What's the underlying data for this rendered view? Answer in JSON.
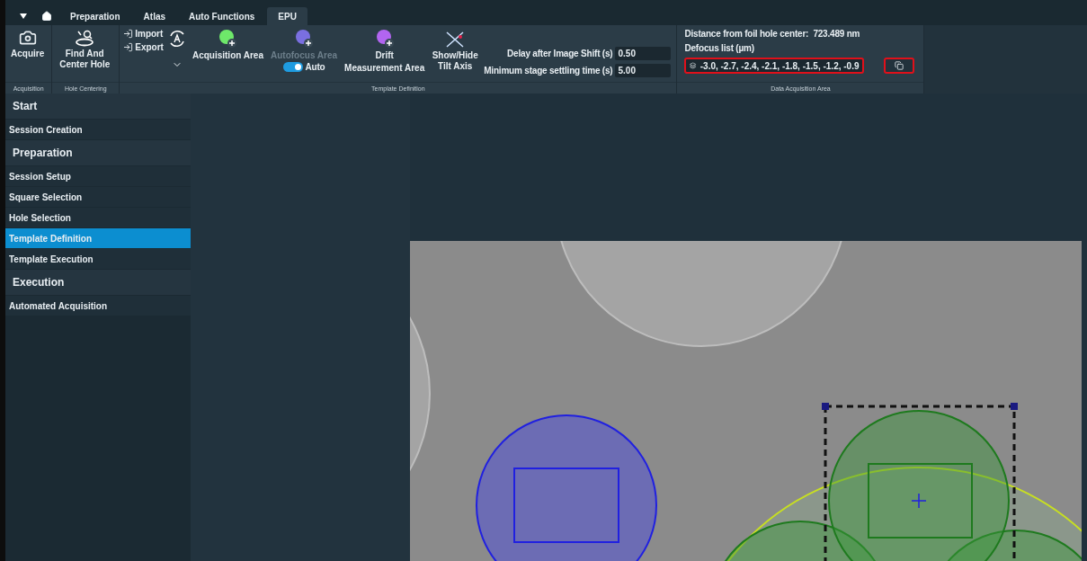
{
  "menu_tabs": [
    {
      "label": "Preparation",
      "selected": false
    },
    {
      "label": "Atlas",
      "selected": false
    },
    {
      "label": "Auto Functions",
      "selected": false
    },
    {
      "label": "EPU",
      "selected": true
    }
  ],
  "ribbon": [
    {
      "label": "Acquisition",
      "items": [
        {
          "kind": "camera",
          "label": "Acquire"
        }
      ]
    },
    {
      "label": "Hole Centering",
      "items": [
        {
          "kind": "find-hole",
          "label": "Find And Center Hole"
        }
      ]
    },
    {
      "label": "Template Definition",
      "items": [
        {
          "kind": "import-export",
          "actions": [
            "Import",
            "Export"
          ]
        },
        {
          "kind": "auto-menu"
        },
        {
          "kind": "area",
          "label": "Acquisition Area",
          "color": "#6ee86a",
          "disabled": false
        },
        {
          "kind": "area-toggle",
          "label": "Autofocus Area",
          "color": "#7a6fe0",
          "disabled": true,
          "toggle": {
            "label": "Auto",
            "on": true
          }
        },
        {
          "kind": "area",
          "label": "Drift Measurement Area",
          "color": "#b265f0",
          "disabled": false
        },
        {
          "kind": "tilt",
          "label": "Show/Hide Tilt Axis"
        },
        {
          "kind": "settings",
          "fields": [
            {
              "label": "Delay after Image Shift (s)",
              "value": "0.50"
            },
            {
              "label": "Minimum stage settling time (s)",
              "value": "5.00"
            }
          ]
        }
      ]
    },
    {
      "label": "Data Acquisition Area",
      "items": [
        {
          "kind": "data",
          "distance_label": "Distance from foil hole center:",
          "distance_value": "723.489 nm",
          "defocus_label": "Defocus list (µm)",
          "defocus_value": "-3.0, -2.7, -2.4, -2.1, -1.8, -1.5, -1.2, -0.9",
          "highlighted": true,
          "copy_highlighted": true
        }
      ]
    }
  ],
  "sidebar": [
    {
      "kind": "header",
      "label": "Start"
    },
    {
      "kind": "item",
      "label": "Session Creation",
      "selected": false
    },
    {
      "kind": "header",
      "label": "Preparation"
    },
    {
      "kind": "item",
      "label": "Session Setup",
      "selected": false
    },
    {
      "kind": "item",
      "label": "Square Selection",
      "selected": false
    },
    {
      "kind": "item",
      "label": "Hole Selection",
      "selected": false
    },
    {
      "kind": "item",
      "label": "Template Definition",
      "selected": true
    },
    {
      "kind": "item",
      "label": "Template Execution",
      "selected": false
    },
    {
      "kind": "header",
      "label": "Execution"
    },
    {
      "kind": "item",
      "label": "Automated Acquisition",
      "selected": false
    }
  ]
}
